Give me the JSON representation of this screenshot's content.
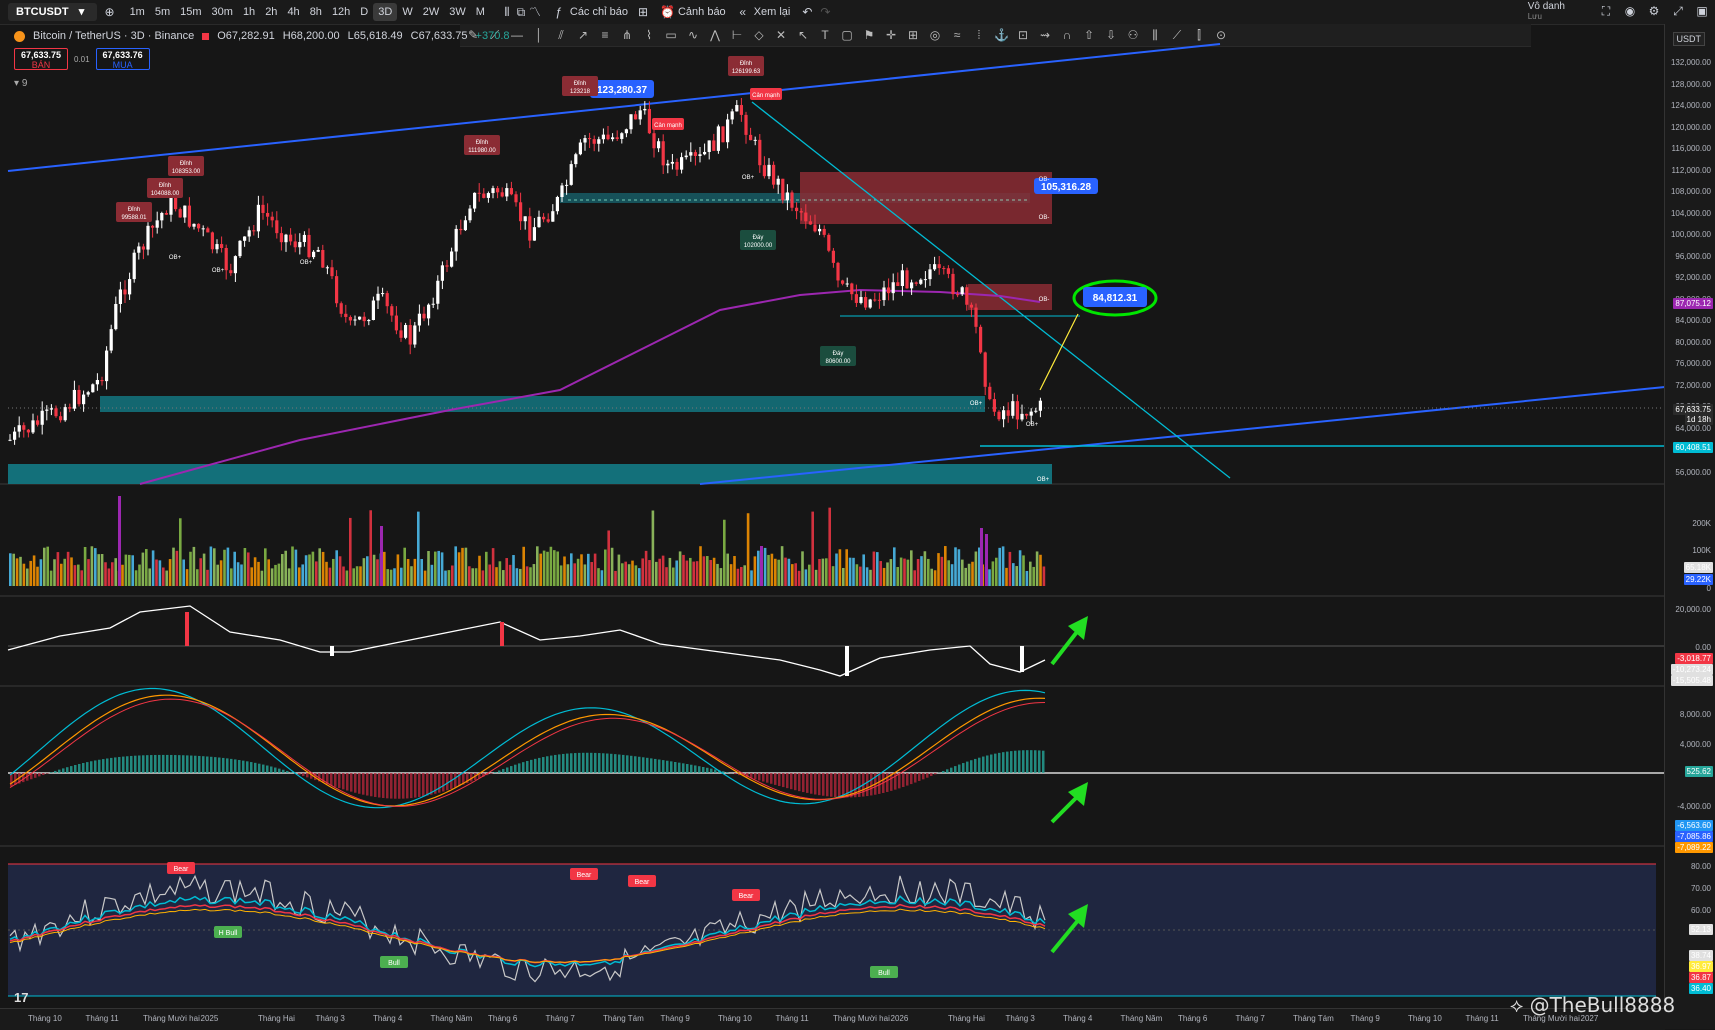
{
  "topbar": {
    "symbol": "BTCUSDT",
    "timeframes": [
      "1m",
      "5m",
      "15m",
      "30m",
      "1h",
      "2h",
      "4h",
      "8h",
      "12h",
      "D",
      "3D",
      "W",
      "2W",
      "3W",
      "M"
    ],
    "active_timeframe": "3D",
    "indicators_label": "Các chỉ báo",
    "alerts_label": "Cảnh báo",
    "replay_label": "Xem lại",
    "user_label": "Vô danh",
    "user_sub": "Lưu"
  },
  "legend": {
    "title": "Bitcoin / TetherUS · 3D · Binance",
    "open": "O67,282.91",
    "high": "H68,200.00",
    "low": "L65,618.49",
    "close": "C67,633.75",
    "change": "+370.8",
    "sell_price": "67,633.75",
    "sell_label": "BÁN",
    "spread": "0.01",
    "buy_price": "67,633.76",
    "buy_label": "MUA",
    "indicator_count": "9"
  },
  "axis": {
    "currency": "USDT",
    "price_ticks": [
      "132,000.00",
      "128,000.00",
      "124,000.00",
      "120,000.00",
      "116,000.00",
      "112,000.00",
      "108,000.00",
      "104,000.00",
      "100,000.00",
      "96,000.00",
      "92,000.00",
      "88,000.00",
      "84,000.00",
      "80,000.00",
      "76,000.00",
      "72,000.00",
      "68,000.00",
      "64,000.00",
      "56,000.00"
    ],
    "price_tags": [
      {
        "text": "87,075.12",
        "color": "#9c27b0"
      },
      {
        "text": "67,633.75",
        "color": "#2a2a2a"
      },
      {
        "text": "1d 18h",
        "color": "#2a2a2a"
      },
      {
        "text": "60,408.51",
        "color": "#00bcd4"
      }
    ],
    "volume_ticks": [
      "200K",
      "100K",
      "0"
    ],
    "volume_tags": [
      {
        "text": "65.18K",
        "color": "#e0e0e0"
      },
      {
        "text": "29.22K",
        "color": "#2962ff"
      }
    ],
    "cvd_ticks": [
      "20,000.00",
      "0.00"
    ],
    "cvd_tags": [
      {
        "text": "-3,018.77",
        "color": "#f23645"
      },
      {
        "text": "-10,273.24",
        "color": "#e0e0e0"
      },
      {
        "text": "-15,505.48",
        "color": "#e0e0e0"
      }
    ],
    "macd_ticks": [
      "8,000.00",
      "4,000.00",
      "-4,000.00"
    ],
    "macd_tags": [
      {
        "text": "525.62",
        "color": "#26a69a"
      },
      {
        "text": "-6,563.60",
        "color": "#2196f3"
      },
      {
        "text": "-7,085.86",
        "color": "#2962ff"
      },
      {
        "text": "-7,089.22",
        "color": "#ff9800"
      }
    ],
    "rsi_ticks": [
      "80.00",
      "70.00",
      "60.00",
      "40.00",
      "20.00"
    ],
    "rsi_tags": [
      {
        "text": "52.13",
        "color": "#e0e0e0"
      },
      {
        "text": "38.74",
        "color": "#e0e0e0"
      },
      {
        "text": "36.97",
        "color": "#ffeb3b"
      },
      {
        "text": "36.87",
        "color": "#f23645"
      },
      {
        "text": "36.40",
        "color": "#00bcd4"
      }
    ]
  },
  "time_labels": [
    "Tháng 10",
    "Tháng 11",
    "Tháng Mười hai",
    "2025",
    "Tháng Hai",
    "Tháng 3",
    "Tháng 4",
    "Tháng Năm",
    "Tháng 6",
    "Tháng 7",
    "Tháng Tám",
    "Tháng 9",
    "Tháng 10",
    "Tháng 11",
    "Tháng Mười hai",
    "2026",
    "Tháng Hai",
    "Tháng 3",
    "Tháng 4",
    "Tháng Năm",
    "Tháng 6",
    "Tháng 7",
    "Tháng Tám",
    "Tháng 9",
    "Tháng 10",
    "Tháng 11",
    "Tháng Mười hai",
    "2027"
  ],
  "annotations": {
    "target_price": "84,812.31",
    "top_price": "123,280.37",
    "ob_level": "105,316.28",
    "peaks": [
      {
        "label": "Đỉnh",
        "value": "99588.01"
      },
      {
        "label": "Đỉnh",
        "value": "104088.00"
      },
      {
        "label": "Đỉnh",
        "value": "108353.00"
      },
      {
        "label": "Đỉnh",
        "value": "111980.00"
      },
      {
        "label": "Đỉnh",
        "value": "123218"
      },
      {
        "label": "Đỉnh",
        "value": "126199.63"
      }
    ],
    "troughs": [
      {
        "label": "Đáy",
        "value": "102000.00"
      },
      {
        "label": "Đáy",
        "value": "80600.00"
      }
    ],
    "strong_label": "Cản mạnh",
    "ob_plus": "OB+",
    "ob_minus": "OB-",
    "rsi_labels": [
      "Bear",
      "Bear",
      "Bear",
      "Bear",
      "H Bull",
      "Bull",
      "Bull"
    ]
  },
  "watermark": "@TheBull8888",
  "tv_logo": "17"
}
